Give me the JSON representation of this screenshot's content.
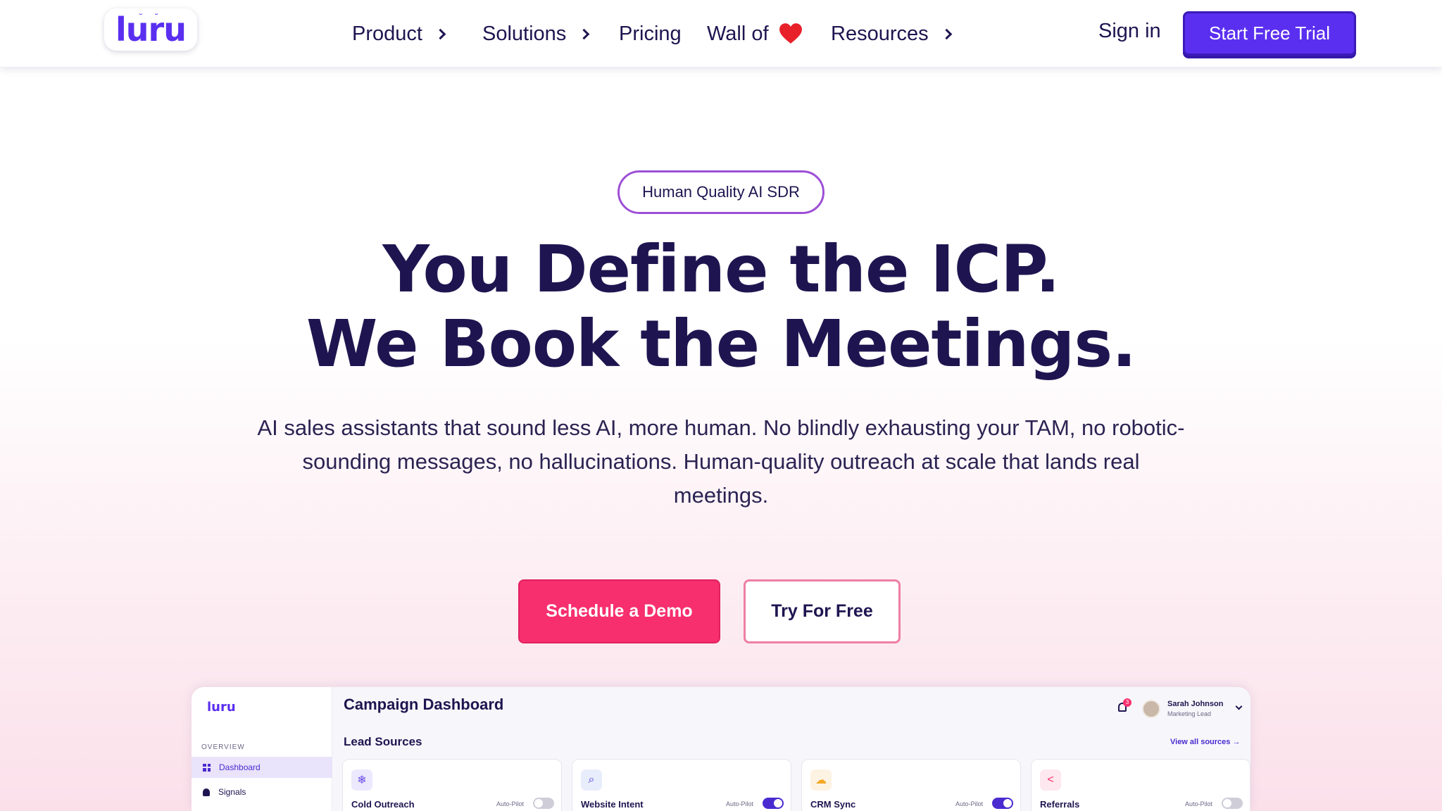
{
  "nav": {
    "logo_text": "luru",
    "items": [
      {
        "label": "Product",
        "has_chevron": true
      },
      {
        "label": "Solutions",
        "has_chevron": true
      },
      {
        "label": "Pricing",
        "has_chevron": false
      },
      {
        "label": "Wall of",
        "has_chevron": false,
        "icon": "heart-icon"
      },
      {
        "label": "Resources",
        "has_chevron": true
      }
    ],
    "sign_in": "Sign in",
    "cta": "Start Free Trial"
  },
  "hero": {
    "badge": "Human Quality AI SDR",
    "headline_line1": "You Define the ICP.",
    "headline_line2": "We Book the Meetings.",
    "subtext": "AI sales assistants that sound less AI, more human. No blindly exhausting your TAM, no robotic-sounding messages, no hallucinations. Human-quality  outreach at scale that lands real meetings.",
    "primary_button": "Schedule a Demo",
    "secondary_button": "Try For Free"
  },
  "dashboard": {
    "logo_text": "luru",
    "sidebar_section": "OVERVIEW",
    "sidebar_items": [
      {
        "label": "Dashboard",
        "icon": "grid-icon",
        "active": true
      },
      {
        "label": "Signals",
        "icon": "bell-icon",
        "active": false
      }
    ],
    "title": "Campaign Dashboard",
    "notification_count": "3",
    "user_name": "Sarah Johnson",
    "user_role": "Marketing Lead",
    "section_title": "Lead Sources",
    "view_all": "View all sources →",
    "cards": [
      {
        "name": "Cold Outreach",
        "auto_label": "Auto-Pilot",
        "on": false,
        "icon": "snowflake-icon",
        "color": "#6a4de8",
        "bg": "#ece8fd"
      },
      {
        "name": "Website Intent",
        "auto_label": "Auto-Pilot",
        "on": true,
        "icon": "globe-search-icon",
        "color": "#4a2bd0",
        "bg": "#e8edfb"
      },
      {
        "name": "CRM Sync",
        "auto_label": "Auto-Pilot",
        "on": true,
        "icon": "cloud-icon",
        "color": "#f5a623",
        "bg": "#fdf3e2"
      },
      {
        "name": "Referrals",
        "auto_label": "Auto-Pilot",
        "on": false,
        "icon": "share-icon",
        "color": "#f72f6e",
        "bg": "#fde8ef"
      }
    ]
  },
  "colors": {
    "brand_purple": "#5a2ff0",
    "cta_pink": "#f72f6e",
    "text_dark": "#1e1550",
    "badge_border": "#9d4fd6"
  }
}
